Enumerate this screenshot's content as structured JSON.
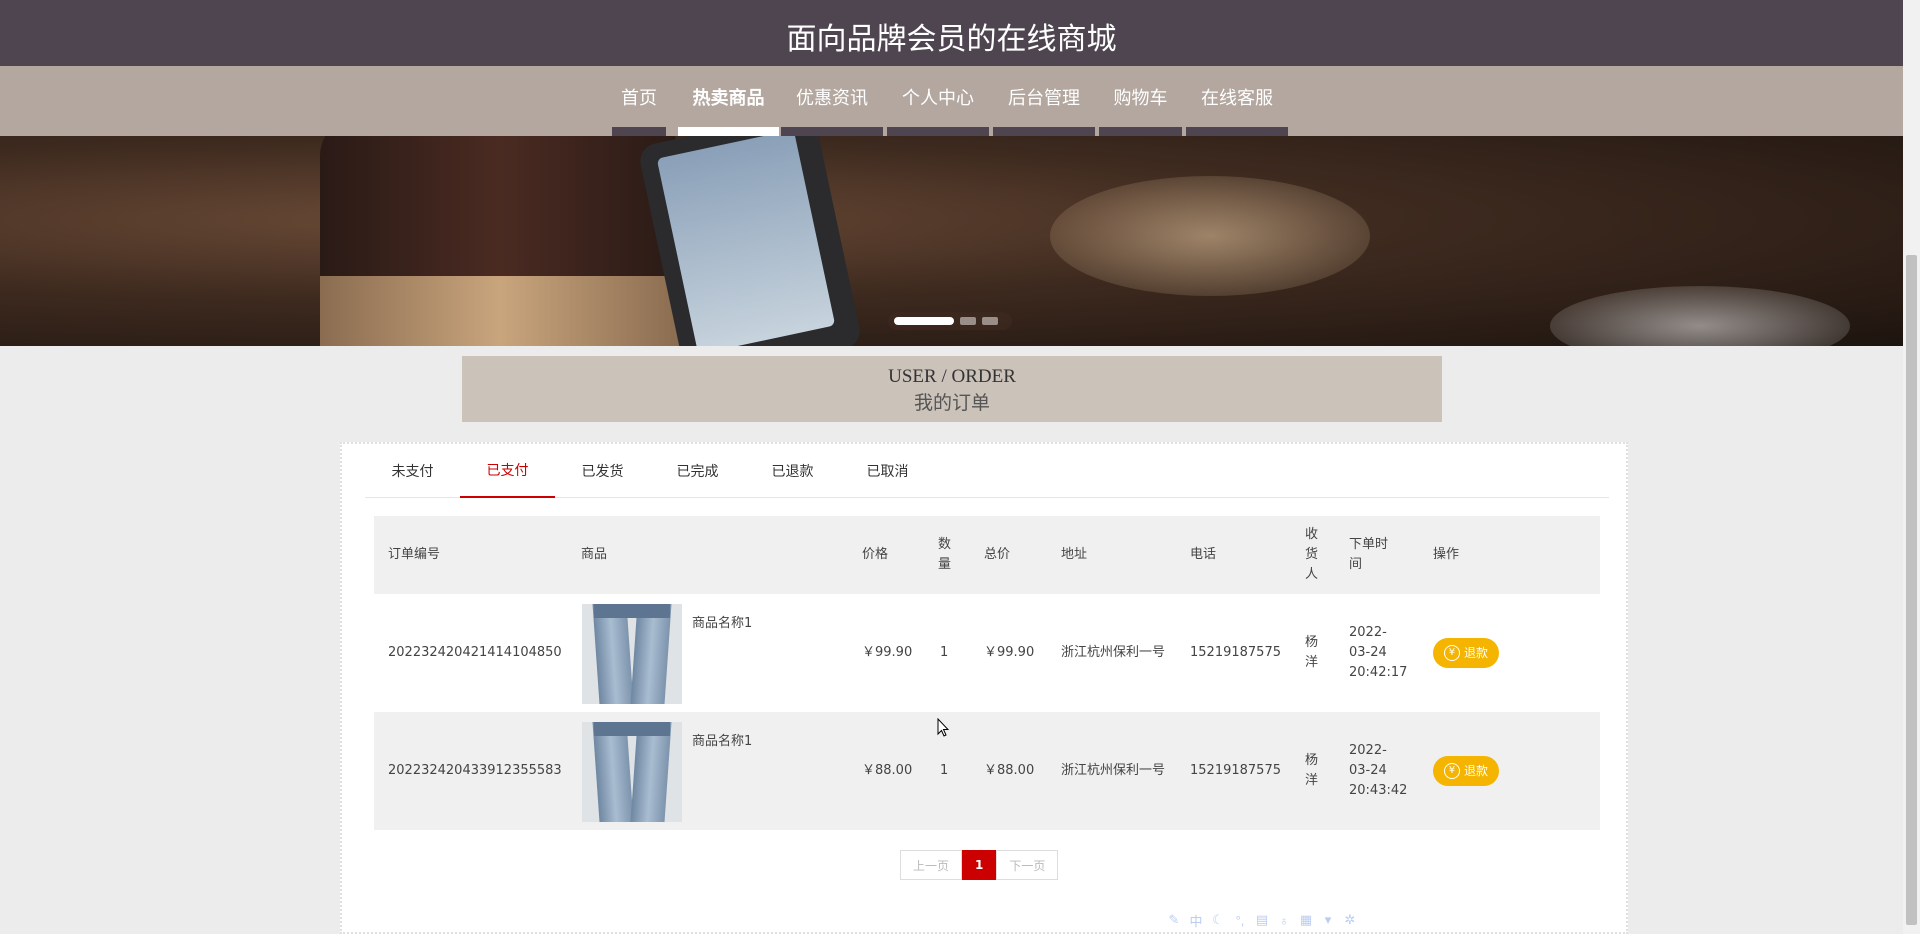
{
  "header": {
    "site_title": "面向品牌会员的在线商城"
  },
  "nav": {
    "items": [
      {
        "label": "首页",
        "active": false
      },
      {
        "label": "热卖商品",
        "active": true
      },
      {
        "label": "优惠资讯",
        "active": false
      },
      {
        "label": "个人中心",
        "active": false
      },
      {
        "label": "后台管理",
        "active": false
      },
      {
        "label": "购物车",
        "active": false
      },
      {
        "label": "在线客服",
        "active": false
      }
    ]
  },
  "banner": {
    "slides": 3,
    "active_slide": 1
  },
  "section": {
    "title_en": "USER / ORDER",
    "title_cn": "我的订单"
  },
  "tabs": [
    {
      "label": "未支付",
      "active": false
    },
    {
      "label": "已支付",
      "active": true
    },
    {
      "label": "已发货",
      "active": false
    },
    {
      "label": "已完成",
      "active": false
    },
    {
      "label": "已退款",
      "active": false
    },
    {
      "label": "已取消",
      "active": false
    }
  ],
  "table": {
    "headers": {
      "order_no": "订单编号",
      "product": "商品",
      "price": "价格",
      "qty": "数量",
      "total": "总价",
      "address": "地址",
      "phone": "电话",
      "receiver": "收货人",
      "order_time": "下单时间",
      "action": "操作"
    },
    "rows": [
      {
        "order_no": "202232420421414104850",
        "product_name": "商品名称1",
        "price": "￥99.90",
        "qty": "1",
        "total": "￥99.90",
        "address": "浙江杭州保利一号",
        "phone": "15219187575",
        "receiver": "杨洋",
        "order_time": "2022-03-24 20:42:17",
        "action_label": "退款"
      },
      {
        "order_no": "202232420433912355583",
        "product_name": "商品名称1",
        "price": "￥88.00",
        "qty": "1",
        "total": "￥88.00",
        "address": "浙江杭州保利一号",
        "phone": "15219187575",
        "receiver": "杨洋",
        "order_time": "2022-03-24 20:43:42",
        "action_label": "退款"
      }
    ]
  },
  "pagination": {
    "prev": "上一页",
    "current": "1",
    "next": "下一页"
  },
  "ime_toolbar": {
    "lang": "中"
  },
  "colors": {
    "topbar": "#4f4551",
    "navbar": "#b3a79f",
    "accent": "#cc0000",
    "refund": "#f4b400"
  }
}
